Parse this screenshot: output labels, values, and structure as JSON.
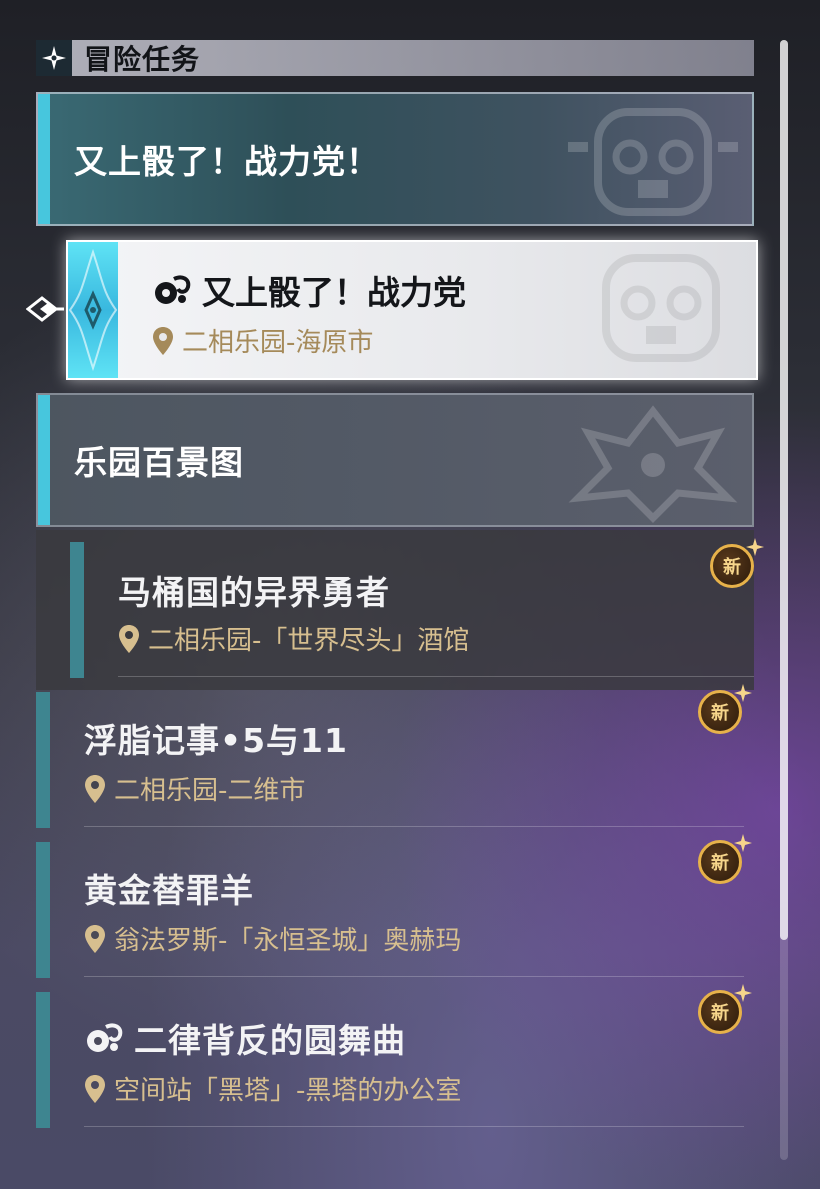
{
  "header": {
    "title": "冒险任务",
    "icon": "four-point-star-icon"
  },
  "categories": [
    {
      "label": "又上骰了！战力党！",
      "watermark": "mascot-emblem-icon"
    },
    {
      "label": "乐园百景图",
      "watermark": "dragon-emblem-icon"
    }
  ],
  "selected_quest": {
    "title": "又上骰了！战力党",
    "location": "二相乐园-海原市",
    "type_icon": "elation-path-icon"
  },
  "quests": [
    {
      "title": "马桶国的异界勇者",
      "location": "二相乐园-「世界尽头」酒馆",
      "badge": "新"
    },
    {
      "title": "浮脂记事•5与11",
      "location": "二相乐园-二维市",
      "badge": "新"
    },
    {
      "title": "黄金替罪羊",
      "location": "翁法罗斯-「永恒圣城」奥赫玛",
      "badge": "新"
    },
    {
      "title": "二律背反的圆舞曲",
      "location": "空间站「黑塔」-黑塔的办公室",
      "badge": "新",
      "type_icon": "elation-path-icon"
    }
  ],
  "colors": {
    "accent_cyan": "#47c6dd",
    "accent_teal": "#3e8590",
    "location_gold": "#d7bf8f",
    "badge_gold": "#e7b24a"
  }
}
